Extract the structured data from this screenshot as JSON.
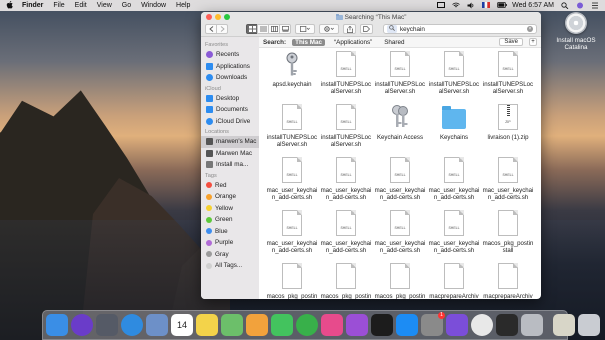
{
  "menubar": {
    "app_name": "Finder",
    "items": [
      "File",
      "Edit",
      "View",
      "Go",
      "Window",
      "Help"
    ],
    "clock": "Wed 6:57 AM"
  },
  "desktop_icon": {
    "label": "Install macOS Catalina",
    "icon": "disk-icon"
  },
  "window": {
    "title": "Searching “This Mac”",
    "search": {
      "value": "keychain",
      "token_icon": "magnifier-icon"
    }
  },
  "sidebar": {
    "favorites_header": "Favorites",
    "favorites": [
      {
        "label": "Recents",
        "icon": "clock-icon",
        "color": "#8a5ad6"
      },
      {
        "label": "Applications",
        "icon": "applications-icon",
        "color": "#2d8cf0"
      },
      {
        "label": "Downloads",
        "icon": "downloads-icon",
        "color": "#2d8cf0"
      }
    ],
    "icloud_header": "iCloud",
    "icloud": [
      {
        "label": "Desktop",
        "icon": "desktop-icon",
        "color": "#2d8cf0"
      },
      {
        "label": "Documents",
        "icon": "documents-icon",
        "color": "#2d8cf0"
      },
      {
        "label": "iCloud Drive",
        "icon": "cloud-icon",
        "color": "#2d8cf0"
      }
    ],
    "locations_header": "Locations",
    "locations": [
      {
        "label": "marwen's Mac",
        "icon": "laptop-icon",
        "color": "#555555",
        "selected": true
      },
      {
        "label": "Marwen Mac",
        "icon": "laptop-icon",
        "color": "#555555"
      },
      {
        "label": "Install ma...",
        "icon": "disk-icon",
        "color": "#777777"
      }
    ],
    "tags_header": "Tags",
    "tags": [
      {
        "label": "Red",
        "color": "#f44e3f"
      },
      {
        "label": "Orange",
        "color": "#f7a12c"
      },
      {
        "label": "Yellow",
        "color": "#f5d130"
      },
      {
        "label": "Green",
        "color": "#5cc93b"
      },
      {
        "label": "Blue",
        "color": "#3d8ef0"
      },
      {
        "label": "Purple",
        "color": "#b06bd6"
      },
      {
        "label": "Gray",
        "color": "#9b9b9b"
      },
      {
        "label": "All Tags...",
        "color": "#d0d0d0"
      }
    ]
  },
  "scopebar": {
    "label": "Search:",
    "scopes": [
      "This Mac",
      "“Applications”",
      "Shared"
    ],
    "save": "Save",
    "add": "+"
  },
  "files": [
    {
      "name": "apsd.keychain",
      "kind": "keys"
    },
    {
      "name": "installTUNEPSLocalServer.sh",
      "kind": "shell"
    },
    {
      "name": "installTUNEPSLocalServer.sh",
      "kind": "shell"
    },
    {
      "name": "installTUNEPSLocalServer.sh",
      "kind": "shell"
    },
    {
      "name": "installTUNEPSLocalServer.sh",
      "kind": "shell"
    },
    {
      "name": "installTUNEPSLocalServer.sh",
      "kind": "shell"
    },
    {
      "name": "installTUNEPSLocalServer.sh",
      "kind": "shell"
    },
    {
      "name": "Keychain Access",
      "kind": "keychain-app"
    },
    {
      "name": "Keychains",
      "kind": "folder"
    },
    {
      "name": "livraison (1).zip",
      "kind": "zip"
    },
    {
      "name": "mac_user_keychain_add-certs.sh",
      "kind": "shell"
    },
    {
      "name": "mac_user_keychain_add-certs.sh",
      "kind": "shell"
    },
    {
      "name": "mac_user_keychain_add-certs.sh",
      "kind": "shell"
    },
    {
      "name": "mac_user_keychain_add-certs.sh",
      "kind": "shell"
    },
    {
      "name": "mac_user_keychain_add-certs.sh",
      "kind": "shell"
    },
    {
      "name": "mac_user_keychain_add-certs.sh",
      "kind": "shell"
    },
    {
      "name": "mac_user_keychain_add-certs.sh",
      "kind": "shell"
    },
    {
      "name": "mac_user_keychain_add-certs.sh",
      "kind": "shell"
    },
    {
      "name": "mac_user_keychain_add-certs.sh",
      "kind": "shell"
    },
    {
      "name": "macos_pkg_postinstall",
      "kind": "doc"
    },
    {
      "name": "macos_pkg_postinstall",
      "kind": "doc"
    },
    {
      "name": "macos_pkg_postinstall",
      "kind": "doc"
    },
    {
      "name": "macos_pkg_postinstall",
      "kind": "doc"
    },
    {
      "name": "macprepareArchiveForMojaveUpdate",
      "kind": "doc"
    },
    {
      "name": "macprepareArchiveForMojaveUpdate",
      "kind": "doc"
    }
  ],
  "shell_label": "SHELL",
  "zip_label": "ZIP",
  "dock": [
    {
      "name": "finder",
      "color": "#3a8ee6"
    },
    {
      "name": "siri",
      "color": "#6a3cc9"
    },
    {
      "name": "launchpad",
      "color": "#555a66"
    },
    {
      "name": "safari",
      "color": "#2f8be0"
    },
    {
      "name": "preview",
      "color": "#6d90c8"
    },
    {
      "name": "calendar",
      "color": "#ffffff",
      "text": "14"
    },
    {
      "name": "notes",
      "color": "#f3d34a"
    },
    {
      "name": "maps",
      "color": "#6cbf6a"
    },
    {
      "name": "photos",
      "color": "#f2a23c"
    },
    {
      "name": "messages",
      "color": "#43c35e"
    },
    {
      "name": "facetime",
      "color": "#38b04a"
    },
    {
      "name": "itunes",
      "color": "#e74b8c"
    },
    {
      "name": "podcasts",
      "color": "#9b4fd6"
    },
    {
      "name": "apple-tv",
      "color": "#1c1c1c"
    },
    {
      "name": "app-store",
      "color": "#1c8cf4"
    },
    {
      "name": "system-preferences",
      "color": "#8a8a8a",
      "badge": "1"
    },
    {
      "name": "feedback-assistant",
      "color": "#7b4ed9"
    },
    {
      "name": "chrome",
      "color": "#e8e8e8"
    },
    {
      "name": "terminal",
      "color": "#2a2a2a"
    },
    {
      "name": "keychain-access",
      "color": "#b9bcc2"
    },
    {
      "name": "downloads-stack",
      "color": "#d8d6c8"
    },
    {
      "name": "trash",
      "color": "#c9ccd2"
    }
  ]
}
